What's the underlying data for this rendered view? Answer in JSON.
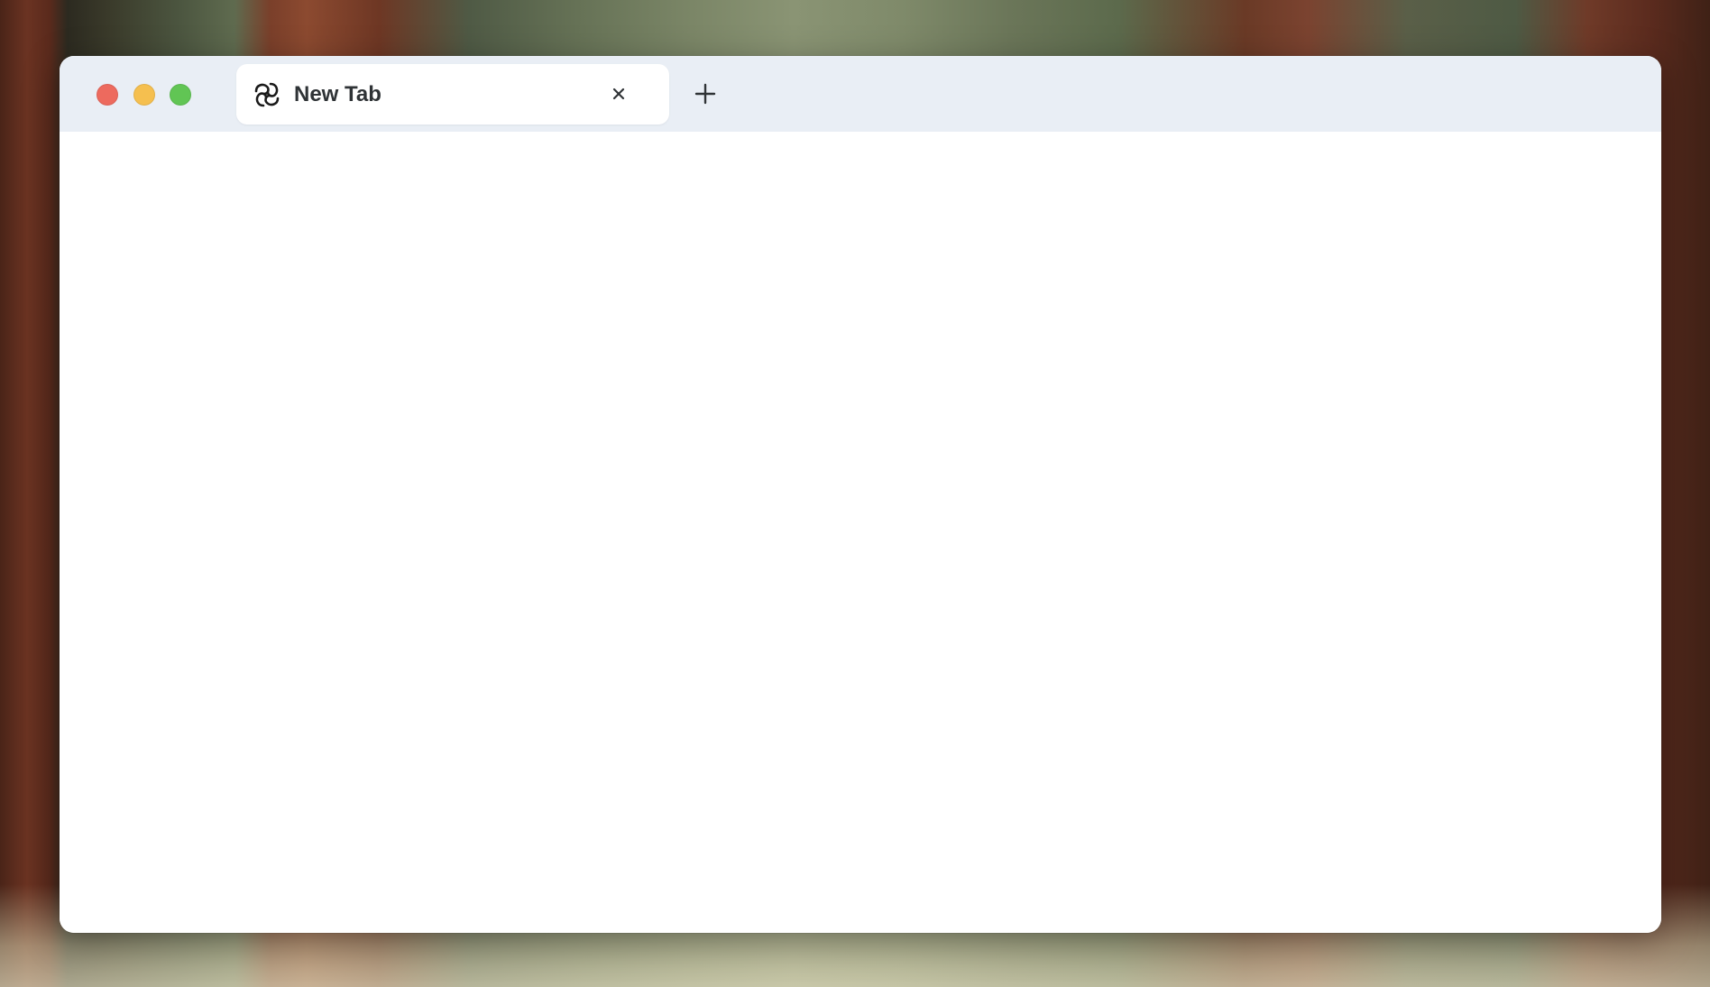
{
  "window": {
    "controls": {
      "close_color": "#ed6a5e",
      "minimize_color": "#f5bf4f",
      "maximize_color": "#61c554"
    }
  },
  "tabs": [
    {
      "title": "New Tab",
      "icon": "browser-logo-icon",
      "active": true,
      "close_icon": "close-icon"
    }
  ],
  "toolbar": {
    "new_tab_icon": "plus-icon"
  },
  "colors": {
    "titlebar_bg": "#e9eef5",
    "tab_bg": "#ffffff",
    "content_bg": "#ffffff"
  }
}
